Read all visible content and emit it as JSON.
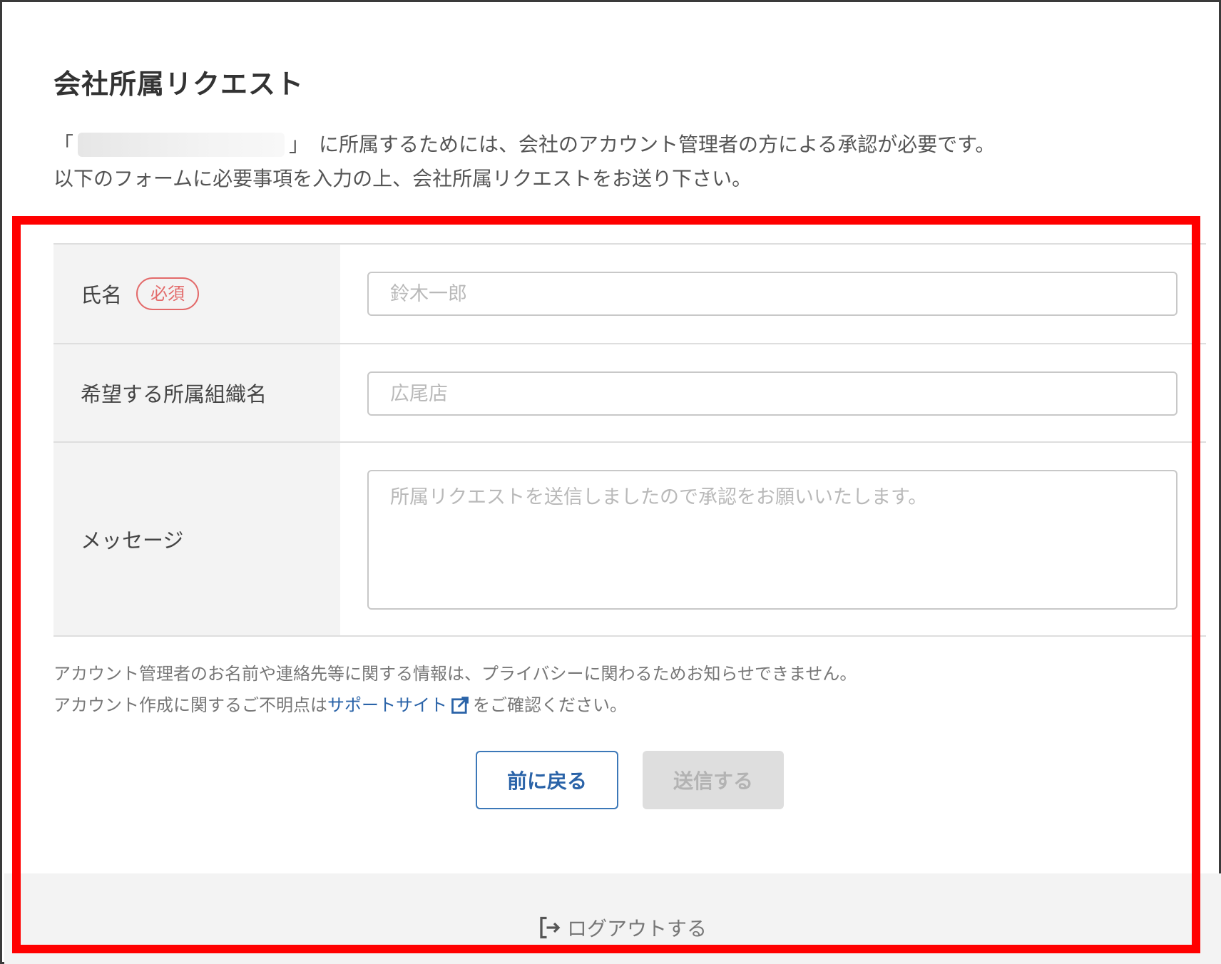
{
  "page": {
    "title": "会社所属リクエスト",
    "intro": {
      "line1_open": "「",
      "line1_close": "」",
      "line1_rest": "に所属するためには、会社のアカウント管理者の方による承認が必要です。",
      "line2": "以下のフォームに必要事項を入力の上、会社所属リクエストをお送り下さい。"
    }
  },
  "form": {
    "name": {
      "label": "氏名",
      "required_badge": "必須",
      "placeholder": "鈴木一郎",
      "value": ""
    },
    "org": {
      "label": "希望する所属組織名",
      "placeholder": "広尾店",
      "value": ""
    },
    "message": {
      "label": "メッセージ",
      "placeholder": "所属リクエストを送信しましたので承認をお願いいたします。",
      "value": ""
    }
  },
  "notes": {
    "line1": "アカウント管理者のお名前や連絡先等に関する情報は、プライバシーに関わるためお知らせできません。",
    "line2_prefix": "アカウント作成に関するご不明点は",
    "support_link": "サポートサイト",
    "line2_suffix": "をご確認ください。"
  },
  "buttons": {
    "back": "前に戻る",
    "send": "送信する"
  },
  "footer": {
    "logout": "ログアウトする"
  },
  "icons": {
    "external_link": "external-link-icon",
    "logout": "logout-icon"
  },
  "colors": {
    "required": "#e36a6a",
    "link": "#2a63a8",
    "highlight": "#ff0000",
    "disabled_button_bg": "#dedede"
  }
}
